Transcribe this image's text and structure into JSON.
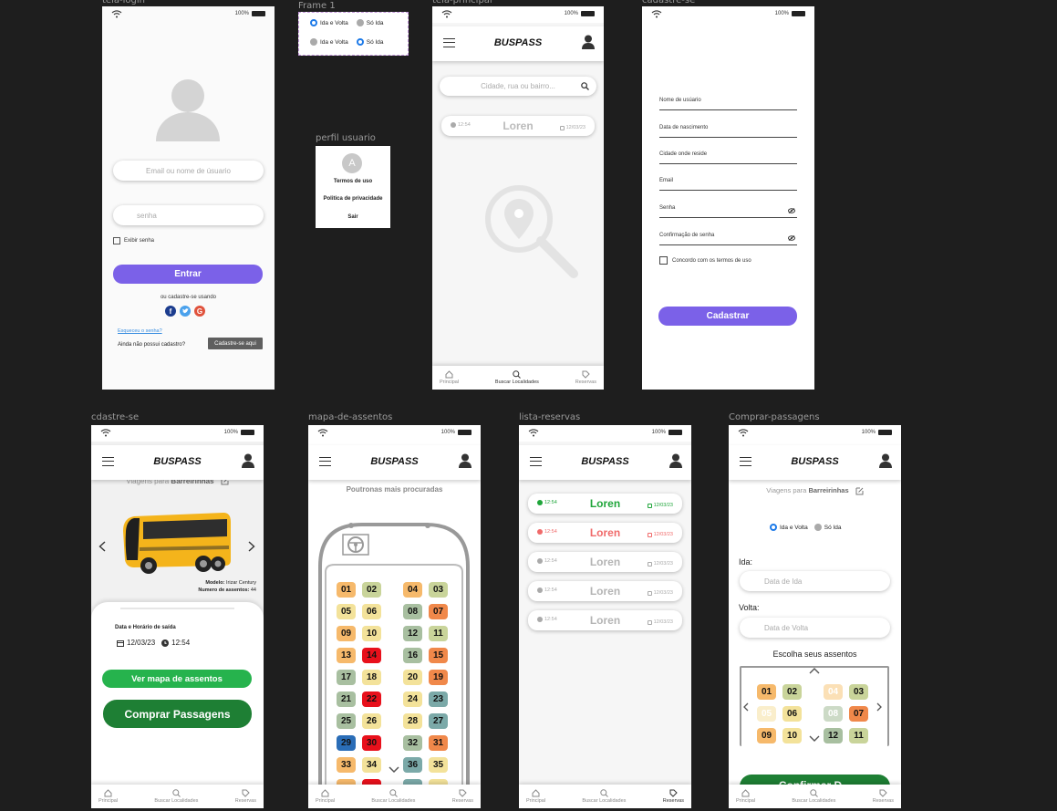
{
  "frames": {
    "login": "tela-login",
    "frame1": "Frame 1",
    "perfil": "perfil usuario",
    "principal": "tela-principal",
    "cadastre": "cadastre-se",
    "cdastre": "cdastre-se",
    "mapa": "mapa-de-assentos",
    "lista": "lista-reservas",
    "comprar": "Comprar-passagens"
  },
  "status": {
    "battery": "100%"
  },
  "app": {
    "logo": "BUSPASS"
  },
  "tabs": [
    "Principal",
    "Buscar Localidades",
    "Reservas"
  ],
  "login": {
    "user_placeholder": "Email ou nome de úsuario",
    "pass_placeholder": "senha",
    "show_pass": "Exibir senha",
    "enter": "Entrar",
    "or_signup": "ou cadastre-se usando",
    "forgot": "Esqueceu o senha?",
    "no_account": "Ainda não possui cadastro?",
    "signup_here": "Cadastre-se aqui"
  },
  "frame1": {
    "round": "Ida e Volta",
    "oneway": "Só Ida"
  },
  "perfil": {
    "avatar": "A",
    "terms": "Termos de uso",
    "privacy": "Politica de privacidade",
    "exit": "Sair"
  },
  "principal": {
    "search_placeholder": "Cidade, rua ou bairro...",
    "card": {
      "time": "12:54",
      "name": "Loren",
      "date": "12/03/23"
    }
  },
  "cadastro": {
    "fields": [
      "Nome de usúario",
      "Data de nascimento",
      "Cidade onde reside",
      "Email",
      "Senha",
      "Confirmação de senha"
    ],
    "agree": "Concordo com os termos de uso",
    "submit": "Cadastrar"
  },
  "cdastre": {
    "trips_prefix": "Viagens para",
    "trips_city": "Barreirinhas",
    "model_label": "Modelo:",
    "model_value": "Irizar Century",
    "seats_label": "Numero de assentos:",
    "seats_value": "44",
    "datetime_label": "Data e Horário de saída",
    "date": "12/03/23",
    "time": "12:54",
    "map_button": "Ver mapa de assentos",
    "buy_button": "Comprar Passagens"
  },
  "mapa": {
    "title": "Poutronas mais procuradas",
    "seats": [
      {
        "n": "01",
        "c": "#f6b96b"
      },
      {
        "n": "02",
        "c": "#c9d49a"
      },
      {
        "n": "04",
        "c": "#f6b96b"
      },
      {
        "n": "03",
        "c": "#c9d49a"
      },
      {
        "n": "05",
        "c": "#f3e29a"
      },
      {
        "n": "06",
        "c": "#f3e29a"
      },
      {
        "n": "08",
        "c": "#a8bfa0"
      },
      {
        "n": "07",
        "c": "#f0884a"
      },
      {
        "n": "09",
        "c": "#f6b96b"
      },
      {
        "n": "10",
        "c": "#f3e29a"
      },
      {
        "n": "12",
        "c": "#a8bfa0"
      },
      {
        "n": "11",
        "c": "#c9d49a"
      },
      {
        "n": "13",
        "c": "#f6b96b"
      },
      {
        "n": "14",
        "c": "#e8101b"
      },
      {
        "n": "16",
        "c": "#a8bfa0"
      },
      {
        "n": "15",
        "c": "#f0884a"
      },
      {
        "n": "17",
        "c": "#a8bfa0"
      },
      {
        "n": "18",
        "c": "#f3e29a"
      },
      {
        "n": "20",
        "c": "#f3e29a"
      },
      {
        "n": "19",
        "c": "#f0884a"
      },
      {
        "n": "21",
        "c": "#a8bfa0"
      },
      {
        "n": "22",
        "c": "#e8101b"
      },
      {
        "n": "24",
        "c": "#f3e29a"
      },
      {
        "n": "23",
        "c": "#7ba9a8"
      },
      {
        "n": "25",
        "c": "#a8bfa0"
      },
      {
        "n": "26",
        "c": "#f3e29a"
      },
      {
        "n": "28",
        "c": "#f3e29a"
      },
      {
        "n": "27",
        "c": "#7ba9a8"
      },
      {
        "n": "29",
        "c": "#2a6db7"
      },
      {
        "n": "30",
        "c": "#e8101b"
      },
      {
        "n": "32",
        "c": "#a8bfa0"
      },
      {
        "n": "31",
        "c": "#f0884a"
      },
      {
        "n": "33",
        "c": "#f6b96b"
      },
      {
        "n": "34",
        "c": "#f3e29a"
      },
      {
        "n": "36",
        "c": "#7ba9a8"
      },
      {
        "n": "35",
        "c": "#f3e29a"
      }
    ]
  },
  "lista": {
    "cards": [
      {
        "time": "12:54",
        "name": "Loren",
        "date": "12/03/23",
        "color": "#1fa53a"
      },
      {
        "time": "12:54",
        "name": "Loren",
        "date": "12/03/23",
        "color": "#f06a6a"
      },
      {
        "time": "12:54",
        "name": "Loren",
        "date": "12/03/23",
        "color": "#aaaaaa"
      },
      {
        "time": "12:54",
        "name": "Loren",
        "date": "12/03/23",
        "color": "#aaaaaa"
      },
      {
        "time": "12:54",
        "name": "Loren",
        "date": "12/03/23",
        "color": "#aaaaaa"
      }
    ]
  },
  "comprar": {
    "trips_prefix": "Viagens para",
    "trips_city": "Barreirinhas",
    "round": "Ida e Volta",
    "oneway": "Só Ida",
    "ida_label": "Ida:",
    "ida_placeholder": "Data de Ida",
    "volta_label": "Volta:",
    "volta_placeholder": "Data de Volta",
    "choose": "Escolha  seus assentos",
    "seats": [
      {
        "n": "01",
        "c": "#f6b96b"
      },
      {
        "n": "02",
        "c": "#c9d49a"
      },
      {
        "n": "04",
        "c": "#fbe0b6"
      },
      {
        "n": "03",
        "c": "#c9d49a"
      },
      {
        "n": "05",
        "c": "#faeecb"
      },
      {
        "n": "06",
        "c": "#f3e29a"
      },
      {
        "n": "08",
        "c": "#ccdac6"
      },
      {
        "n": "07",
        "c": "#f0884a"
      },
      {
        "n": "09",
        "c": "#f6b96b"
      },
      {
        "n": "10",
        "c": "#f3e29a"
      },
      {
        "n": "12",
        "c": "#a8bfa0"
      },
      {
        "n": "11",
        "c": "#c9d49a"
      }
    ],
    "confirm": "Confirmar D..."
  }
}
